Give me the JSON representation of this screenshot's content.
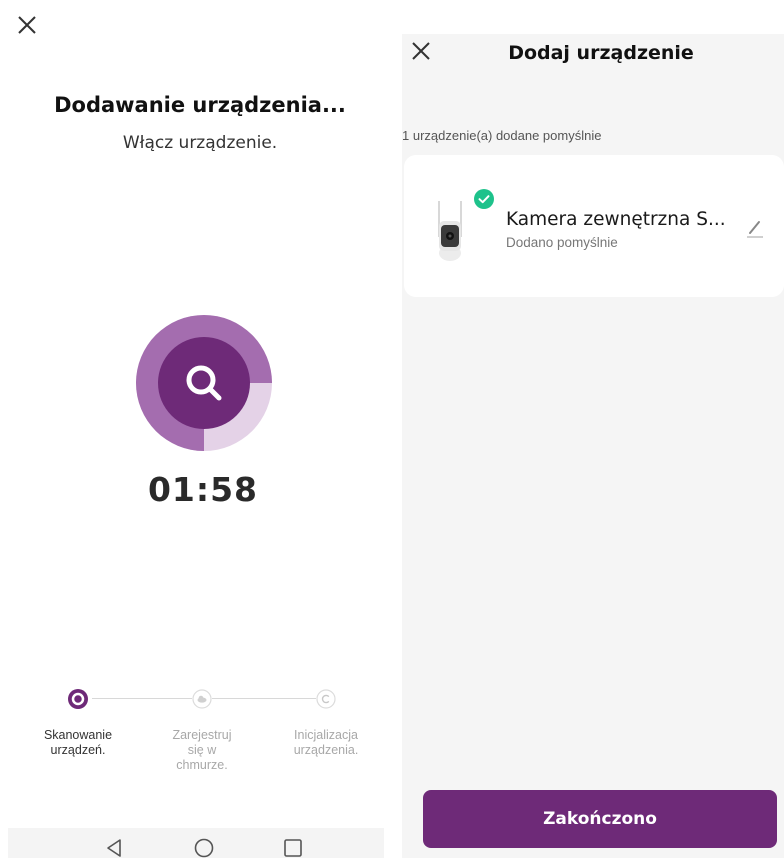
{
  "left": {
    "title": "Dodawanie urządzenia...",
    "subtitle": "Włącz urządzenie.",
    "timer": "01:58",
    "steps": [
      {
        "label_line1": "Skanowanie",
        "label_line2": "urządzeń.",
        "label_line3": "",
        "state": "active"
      },
      {
        "label_line1": "Zarejestruj",
        "label_line2": "się w",
        "label_line3": "chmurze.",
        "state": "pending"
      },
      {
        "label_line1": "Inicjalizacja",
        "label_line2": "urządzenia.",
        "label_line3": "",
        "state": "pending"
      }
    ],
    "scan_progress": 0.25
  },
  "right": {
    "title": "Dodaj urządzenie",
    "section_label": "1 urządzenie(a) dodane pomyślnie",
    "device": {
      "name": "Kamera zewnętrzna S...",
      "status": "Dodano pomyślnie"
    },
    "finish_label": "Zakończono"
  },
  "colors": {
    "accent": "#6e2a78",
    "accent_light": "#b98cc2",
    "accent_ring": "#d7bfdc",
    "success": "#1ec28b"
  },
  "icons": {
    "close": "close-icon",
    "search": "search-icon",
    "cloud": "cloud-icon",
    "copyright": "initialize-icon",
    "edit": "edit-icon",
    "check": "check-icon",
    "back": "back-triangle-icon",
    "home": "home-circle-icon",
    "recent": "recent-square-icon"
  }
}
